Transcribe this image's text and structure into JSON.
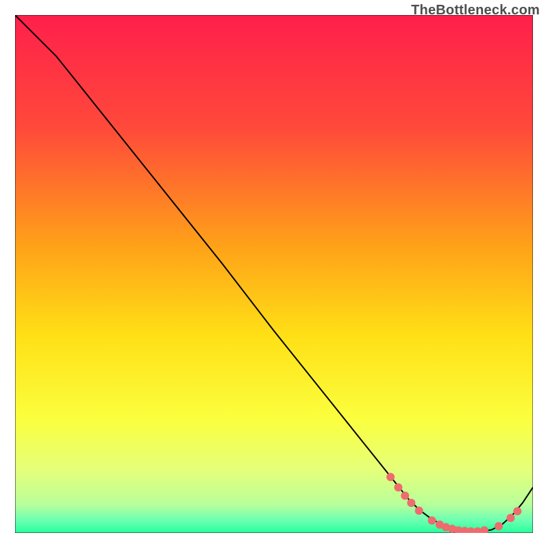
{
  "watermark": "TheBottleneck.com",
  "chart_data": {
    "type": "line",
    "title": "",
    "xlabel": "",
    "ylabel": "",
    "xlim": [
      0,
      100
    ],
    "ylim": [
      0,
      100
    ],
    "grid": false,
    "legend": false,
    "background_gradient": {
      "stops": [
        {
          "offset": 0.0,
          "color": "#ff1f4b"
        },
        {
          "offset": 0.22,
          "color": "#ff4a3a"
        },
        {
          "offset": 0.45,
          "color": "#ffa318"
        },
        {
          "offset": 0.62,
          "color": "#ffe016"
        },
        {
          "offset": 0.78,
          "color": "#fbff3e"
        },
        {
          "offset": 0.88,
          "color": "#e4ff7a"
        },
        {
          "offset": 0.945,
          "color": "#b8ff9a"
        },
        {
          "offset": 0.975,
          "color": "#6dffb2"
        },
        {
          "offset": 1.0,
          "color": "#26ff9c"
        }
      ]
    },
    "series": [
      {
        "name": "curve",
        "x": [
          0,
          4,
          8,
          12,
          20,
          30,
          40,
          50,
          60,
          68,
          72,
          76,
          78,
          80,
          82,
          84,
          86,
          88,
          90,
          92,
          94,
          96,
          98,
          100
        ],
        "y": [
          100,
          96,
          92,
          87,
          77,
          64.5,
          52,
          39,
          26.5,
          16.5,
          11.5,
          6.5,
          4.5,
          3.0,
          1.8,
          1.0,
          0.5,
          0.3,
          0.3,
          0.6,
          1.6,
          3.4,
          5.8,
          8.8
        ]
      }
    ],
    "markers": {
      "name": "highlight-points",
      "color": "#ee6b6e",
      "radius": 6,
      "points": [
        {
          "x": 72.5,
          "y": 10.8
        },
        {
          "x": 74.0,
          "y": 8.8
        },
        {
          "x": 75.3,
          "y": 7.2
        },
        {
          "x": 76.5,
          "y": 5.8
        },
        {
          "x": 78.0,
          "y": 4.3
        },
        {
          "x": 80.5,
          "y": 2.4
        },
        {
          "x": 82.0,
          "y": 1.6
        },
        {
          "x": 83.2,
          "y": 1.1
        },
        {
          "x": 84.4,
          "y": 0.8
        },
        {
          "x": 85.6,
          "y": 0.5
        },
        {
          "x": 86.8,
          "y": 0.4
        },
        {
          "x": 88.0,
          "y": 0.3
        },
        {
          "x": 89.3,
          "y": 0.3
        },
        {
          "x": 90.6,
          "y": 0.5
        },
        {
          "x": 93.4,
          "y": 1.3
        },
        {
          "x": 95.7,
          "y": 2.9
        },
        {
          "x": 97.0,
          "y": 4.2
        }
      ]
    }
  }
}
